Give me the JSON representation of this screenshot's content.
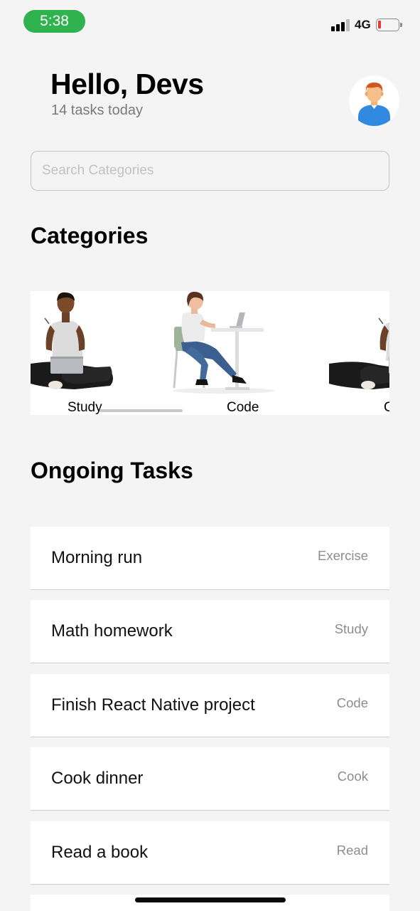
{
  "status_bar": {
    "time": "5:38",
    "network": "4G",
    "battery_icon": "battery-low-icon",
    "signal_icon": "signal-bars-icon"
  },
  "header": {
    "greeting": "Hello, Devs",
    "subtitle": "14 tasks today",
    "avatar_icon": "user-avatar-icon"
  },
  "search": {
    "placeholder": "Search Categories",
    "value": ""
  },
  "categories": {
    "title": "Categories",
    "items": [
      {
        "label": "Study",
        "illustration": "person-with-laptop-illustration"
      },
      {
        "label": "Code",
        "illustration": "person-at-desk-illustration"
      },
      {
        "label": "C",
        "illustration": "person-with-laptop-illustration"
      }
    ]
  },
  "tasks": {
    "title": "Ongoing Tasks",
    "items": [
      {
        "name": "Morning run",
        "category": "Exercise"
      },
      {
        "name": "Math homework",
        "category": "Study"
      },
      {
        "name": "Finish React Native project",
        "category": "Code"
      },
      {
        "name": "Cook dinner",
        "category": "Cook"
      },
      {
        "name": "Read a book",
        "category": "Read"
      }
    ]
  },
  "colors": {
    "accent_green": "#30b24f",
    "background": "#f4f4f4",
    "battery_red": "#e53a32"
  }
}
